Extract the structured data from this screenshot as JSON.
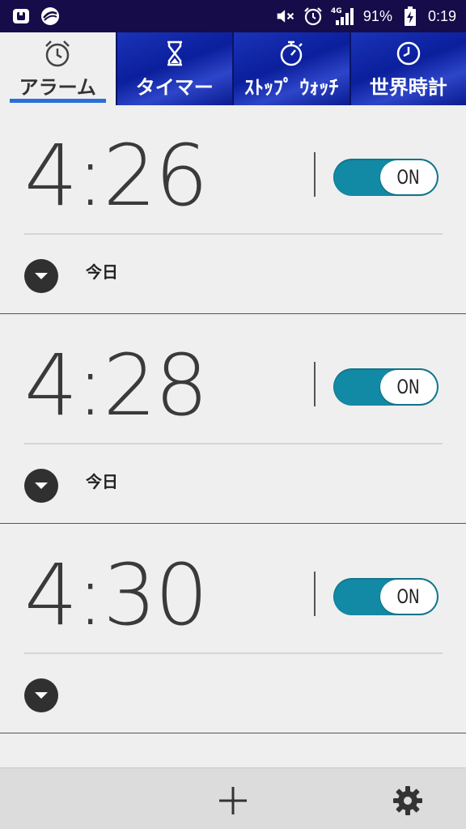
{
  "status_bar": {
    "battery_percent": "91%",
    "time": "0:19",
    "network": "4G",
    "icons": [
      "app-notification-icon",
      "circle-app-icon",
      "mute-icon",
      "alarm-icon",
      "signal-icon",
      "battery-charging-icon"
    ]
  },
  "tabs": [
    {
      "label": "アラーム",
      "icon": "alarm-clock-icon",
      "active": true
    },
    {
      "label": "タイマー",
      "icon": "hourglass-icon",
      "active": false
    },
    {
      "label": "ｽﾄｯﾌﾟ ｳｫｯﾁ",
      "icon": "stopwatch-icon",
      "active": false
    },
    {
      "label": "世界時計",
      "icon": "clock-icon",
      "active": false
    }
  ],
  "alarms": [
    {
      "time": "4:26",
      "toggle": "ON",
      "day": "今日"
    },
    {
      "time": "4:28",
      "toggle": "ON",
      "day": "今日"
    },
    {
      "time": "4:30",
      "toggle": "ON",
      "day": ""
    }
  ],
  "bottom_bar": {
    "add_icon": "plus-icon",
    "settings_icon": "gear-icon"
  },
  "colors": {
    "tab_blue": "#0b1f9c",
    "toggle_on": "#138aa5",
    "status_bar": "#160c4a",
    "active_underline": "#2a6fd6"
  }
}
